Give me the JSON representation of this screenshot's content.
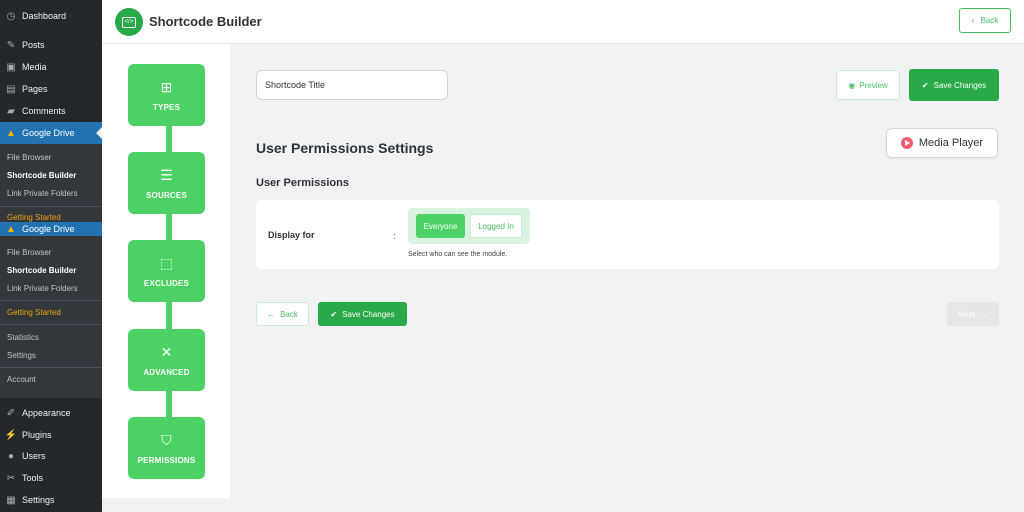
{
  "wp_menu": {
    "top": [
      {
        "label": "Dashboard",
        "icon": "dashboard-icon"
      },
      {
        "label": "Posts",
        "icon": "pin-icon"
      },
      {
        "label": "Media",
        "icon": "media-icon"
      },
      {
        "label": "Pages",
        "icon": "page-icon"
      },
      {
        "label": "Comments",
        "icon": "comment-icon"
      }
    ],
    "google_drive_label": "Google Drive",
    "submenu_1": [
      "File Browser",
      "Shortcode Builder",
      "Link Private Folders",
      "Getting Started"
    ],
    "google_drive_label_2": "Google Drive",
    "submenu_2": [
      "File Browser",
      "Shortcode Builder",
      "Link Private Folders",
      "Getting Started",
      "Statistics",
      "Settings",
      "Account"
    ],
    "bottom": [
      {
        "label": "Appearance",
        "icon": "brush-icon"
      },
      {
        "label": "Plugins",
        "icon": "plug-icon"
      },
      {
        "label": "Users",
        "icon": "user-icon"
      },
      {
        "label": "Tools",
        "icon": "wrench-icon"
      },
      {
        "label": "Settings",
        "icon": "settings-icon"
      }
    ]
  },
  "header": {
    "title": "Shortcode Builder",
    "back_label": "Back"
  },
  "steps": [
    {
      "label": "TYPES",
      "icon": "plus-box-icon"
    },
    {
      "label": "SOURCES",
      "icon": "database-icon"
    },
    {
      "label": "EXCLUDES",
      "icon": "exclude-icon"
    },
    {
      "label": "ADVANCED",
      "icon": "tools-icon"
    },
    {
      "label": "PERMISSIONS",
      "icon": "shield-check-icon"
    }
  ],
  "main": {
    "shortcode_title_value": "Shortcode Title",
    "preview_label": "Preview",
    "save_label": "Save Changes",
    "section_title": "User Permissions Settings",
    "module_type": "Media Player",
    "subsection_title": "User Permissions",
    "display_for_label": "Display for",
    "colon": ":",
    "options": [
      "Everyone",
      "Logged In"
    ],
    "selected_option": "Everyone",
    "help_text": "Select who can see the module.",
    "back_label": "Back",
    "next_label": "Next"
  },
  "colors": {
    "accent": "#4cd264",
    "accent_dark": "#2aa94a",
    "wp_sidebar": "#23282d",
    "wp_active": "#2271b1",
    "orange": "#f0a30a"
  }
}
